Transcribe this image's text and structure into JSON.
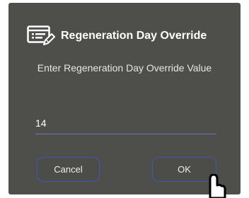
{
  "dialog": {
    "title": "Regeneration Day Override",
    "prompt": "Enter Regeneration Day Override Value",
    "input_value": "14",
    "cancel_label": "Cancel",
    "ok_label": "OK",
    "title_icon": "edit-list-icon",
    "cursor_icon": "hand-pointer-icon"
  },
  "colors": {
    "dialog_background": "#4e4e4a",
    "text": "#ffffff",
    "input_underline": "#6f77c2",
    "button_border": "#3f58b8"
  }
}
